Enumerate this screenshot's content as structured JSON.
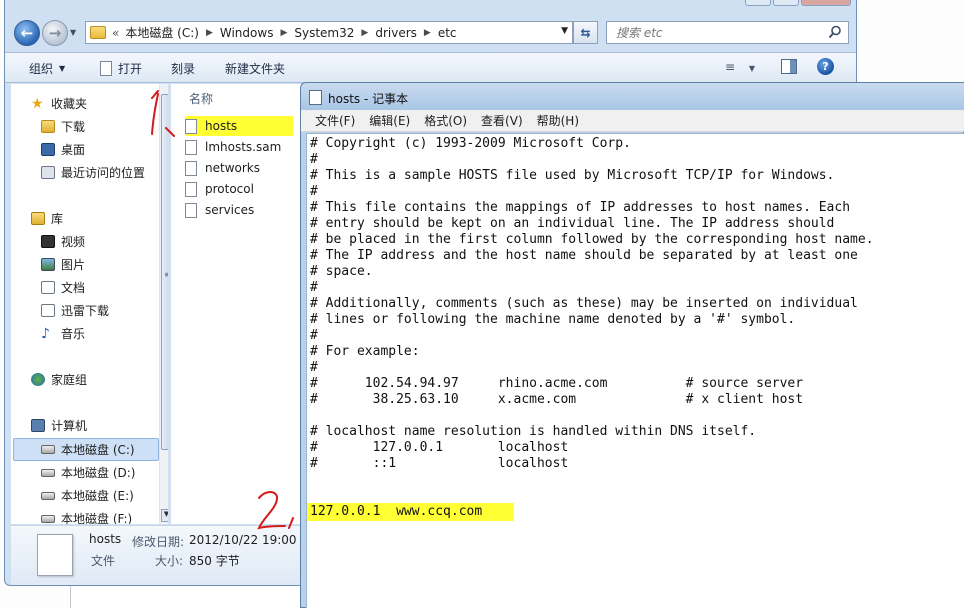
{
  "explorer": {
    "breadcrumb": {
      "chevron": "«",
      "items": [
        "本地磁盘 (C:)",
        "Windows",
        "System32",
        "drivers",
        "etc"
      ]
    },
    "search": {
      "placeholder": "搜索 etc"
    },
    "toolbar": {
      "organize": "组织",
      "open": "打开",
      "burn": "刻录",
      "new_folder": "新建文件夹"
    },
    "nav": {
      "favorites": "收藏夹",
      "downloads": "下载",
      "desktop": "桌面",
      "recent": "最近访问的位置",
      "libraries": "库",
      "videos": "视频",
      "pictures": "图片",
      "documents": "文档",
      "thunder": "迅雷下载",
      "music": "音乐",
      "homegroup": "家庭组",
      "computer": "计算机",
      "drive_c": "本地磁盘 (C:)",
      "drive_d": "本地磁盘 (D:)",
      "drive_e": "本地磁盘 (E:)",
      "drive_f": "本地磁盘 (F:)"
    },
    "files": {
      "column_name": "名称",
      "items": [
        "hosts",
        "lmhosts.sam",
        "networks",
        "protocol",
        "services"
      ]
    },
    "details": {
      "name": "hosts",
      "date_label": "修改日期:",
      "date": "2012/10/22 19:00",
      "type": "文件",
      "size_label": "大小:",
      "size": "850 字节"
    }
  },
  "notepad": {
    "title": "hosts - 记事本",
    "menu": [
      "文件(F)",
      "编辑(E)",
      "格式(O)",
      "查看(V)",
      "帮助(H)"
    ],
    "content": "# Copyright (c) 1993-2009 Microsoft Corp.\n#\n# This is a sample HOSTS file used by Microsoft TCP/IP for Windows.\n#\n# This file contains the mappings of IP addresses to host names. Each\n# entry should be kept on an individual line. The IP address should\n# be placed in the first column followed by the corresponding host name.\n# The IP address and the host name should be separated by at least one\n# space.\n#\n# Additionally, comments (such as these) may be inserted on individual\n# lines or following the machine name denoted by a '#' symbol.\n#\n# For example:\n#\n#      102.54.94.97     rhino.acme.com          # source server\n#       38.25.63.10     x.acme.com              # x client host\n\n# localhost name resolution is handled within DNS itself.\n#\t127.0.0.1       localhost\n#\t::1             localhost",
    "added_entry": "127.0.0.1  www.ccq.com"
  },
  "annotations": {
    "mark1": "1",
    "mark2": "2"
  },
  "colors": {
    "highlight": "#ffff33",
    "annotation": "#d41a1a"
  }
}
